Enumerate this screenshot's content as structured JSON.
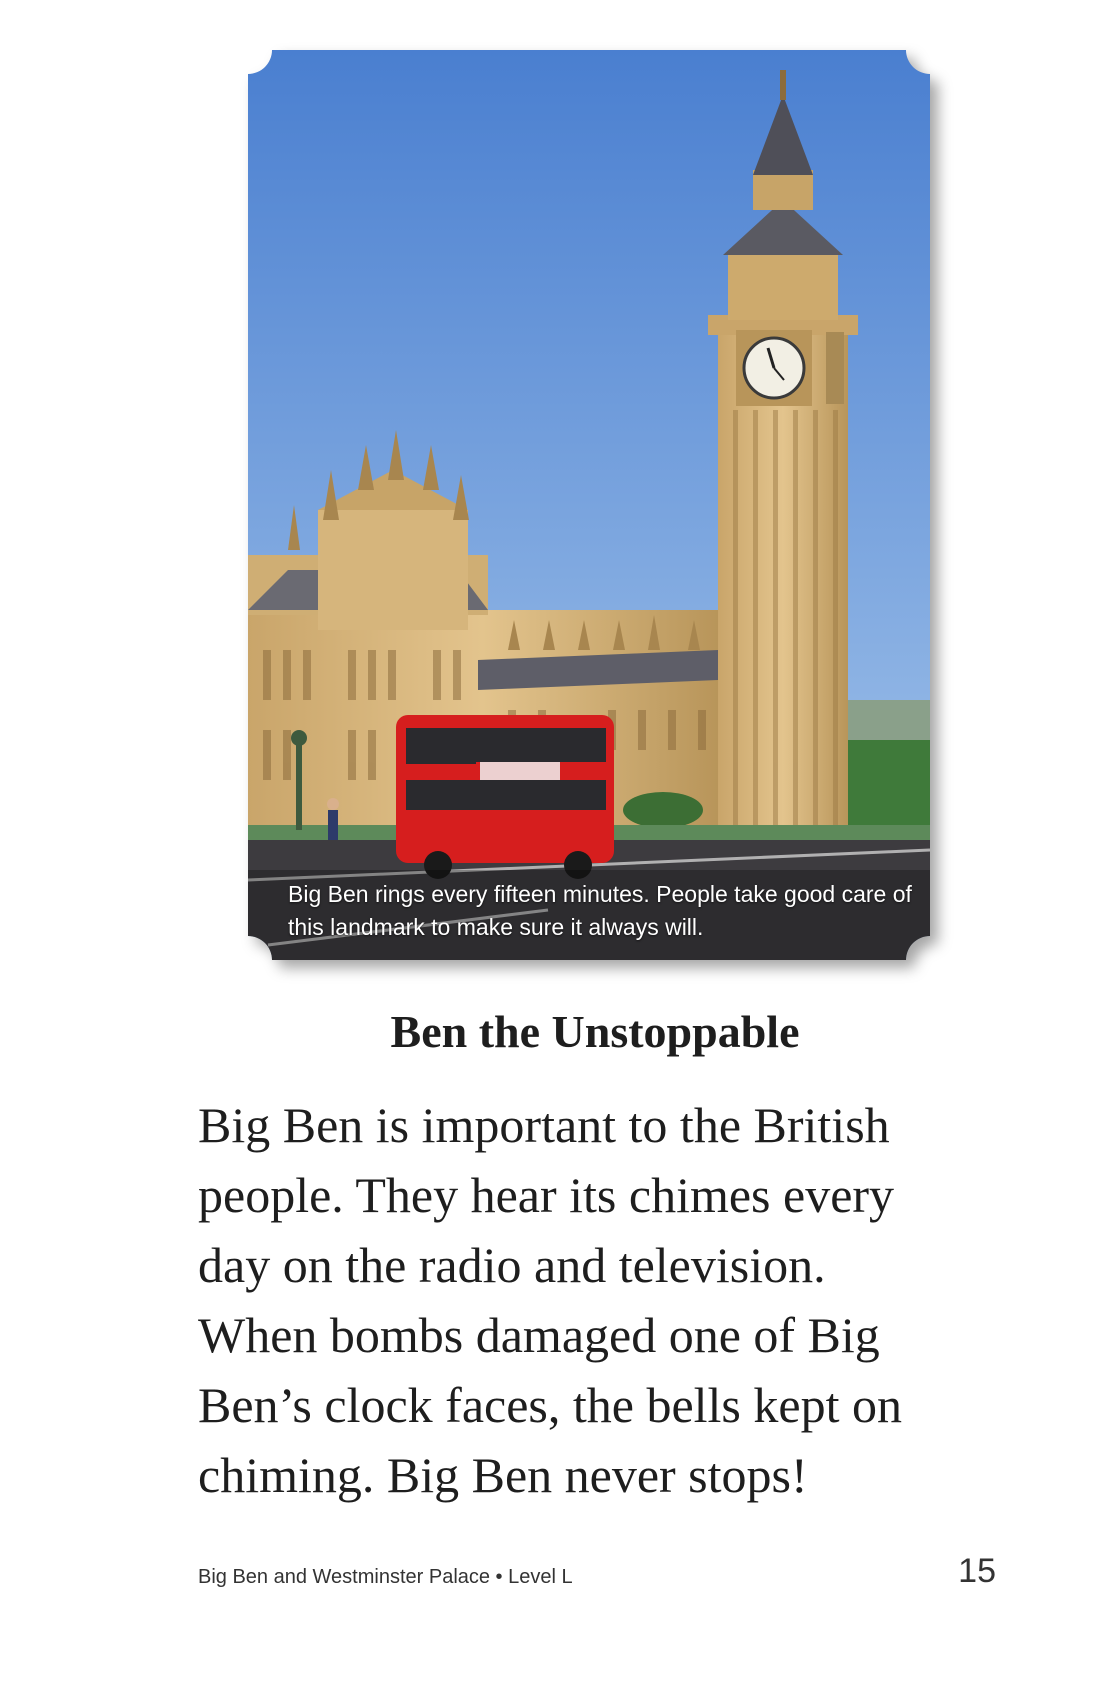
{
  "photo": {
    "caption": "Big Ben rings every fifteen minutes. People take good care of this landmark to make sure it always will.",
    "colors": {
      "sky_top": "#4a7fd0",
      "sky_bottom": "#9cc1ea",
      "stone": "#d8b77e",
      "stone_dark": "#b8955a",
      "roof": "#5a5a62",
      "bus": "#d61e1e",
      "road": "#3d3b3f"
    }
  },
  "heading": "Ben the Unstoppable",
  "body_lines": [
    "Big Ben is important to the British",
    "people. They hear its chimes every",
    "day on the radio and television.",
    "When bombs damaged one of Big",
    "Ben’s clock faces, the bells kept on",
    "chiming. Big Ben never stops!"
  ],
  "footer": {
    "book_title": "Big Ben and Westminster Palace • Level L",
    "page_number": "15"
  }
}
